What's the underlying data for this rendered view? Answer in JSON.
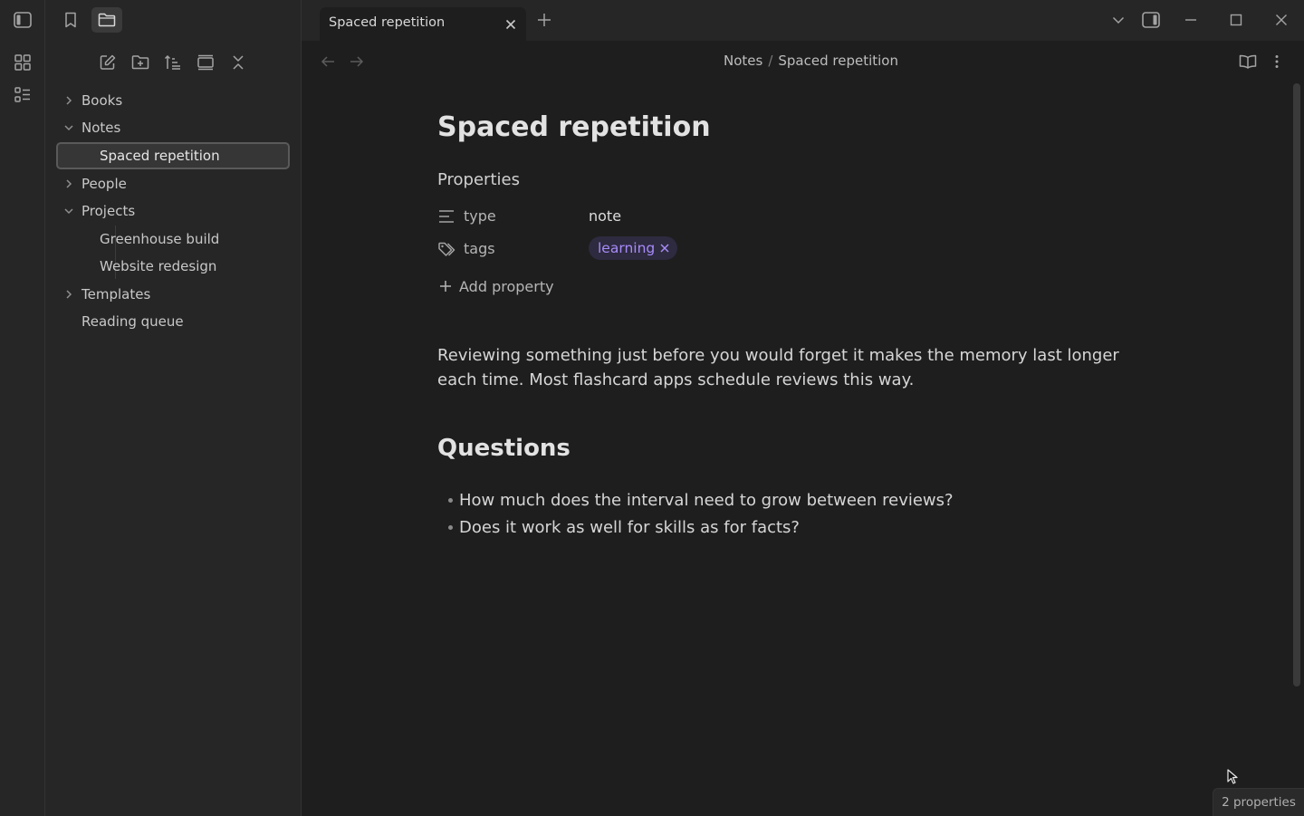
{
  "app": {
    "active_tab_title": "Spaced repetition",
    "breadcrumb": [
      "Notes",
      "Spaced repetition"
    ],
    "breadcrumb_separator": "/"
  },
  "sidebar": {
    "tree": [
      {
        "label": "Books",
        "type": "folder",
        "expanded": false
      },
      {
        "label": "Notes",
        "type": "folder",
        "expanded": true
      },
      {
        "label": "Spaced repetition",
        "type": "file",
        "active": true
      },
      {
        "label": "People",
        "type": "folder",
        "expanded": false
      },
      {
        "label": "Projects",
        "type": "folder",
        "expanded": true
      },
      {
        "label": "Greenhouse build",
        "type": "file"
      },
      {
        "label": "Website redesign",
        "type": "file"
      },
      {
        "label": "Templates",
        "type": "folder",
        "expanded": false
      },
      {
        "label": "Reading queue",
        "type": "file"
      }
    ]
  },
  "note": {
    "title": "Spaced repetition",
    "properties_heading": "Properties",
    "properties": [
      {
        "key": "type",
        "value": "note",
        "icon": "text-lines-icon"
      },
      {
        "key": "tags",
        "value": "learning",
        "icon": "tags-icon"
      }
    ],
    "add_property_label": "Add property",
    "body": "Reviewing something just before you would forget it makes the memory last longer each time. Most flashcard apps schedule reviews this way.",
    "questions_heading": "Questions",
    "questions": [
      "How much does the interval need to grow between reviews?",
      "Does it work as well for skills as for facts?"
    ]
  },
  "status_bar": {
    "properties_count": "2 properties"
  },
  "colors": {
    "background": "#1e1e1e",
    "sidebar": "#262626",
    "tag_text": "#a78bfa",
    "tag_background": "#2e2a3f"
  }
}
